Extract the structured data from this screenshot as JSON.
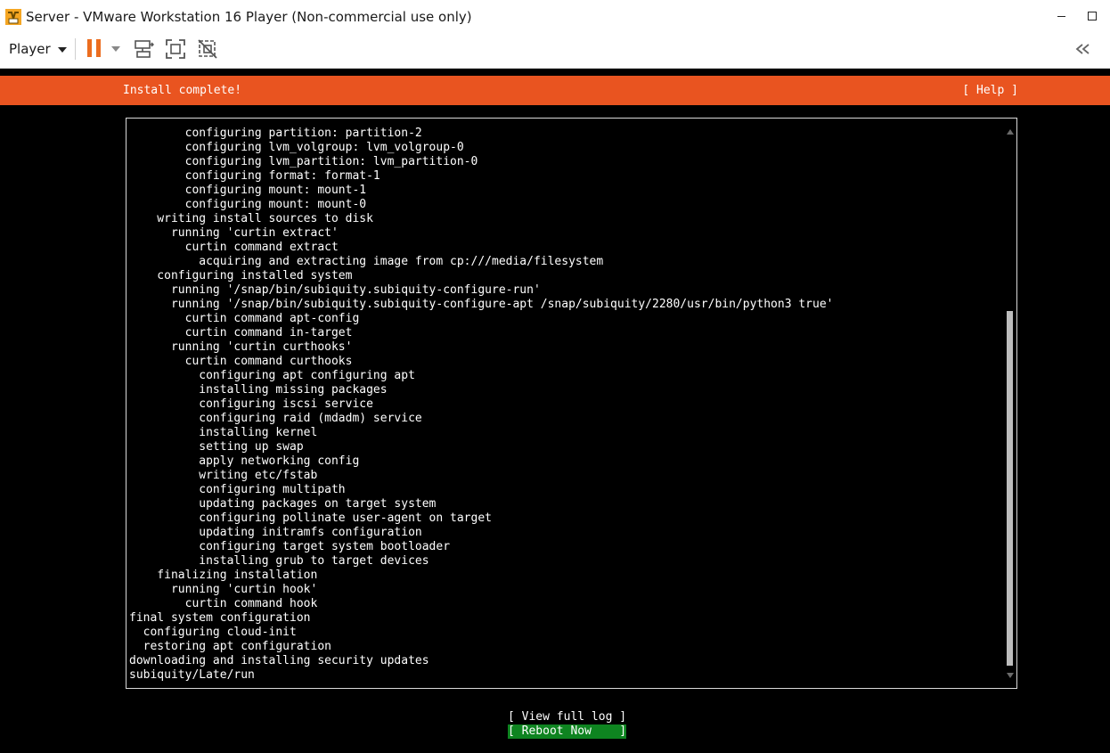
{
  "window": {
    "title": "Server - VMware Workstation 16 Player (Non-commercial use only)",
    "app_icon": "vmware-icon",
    "controls": [
      "minimize-icon",
      "maximize-icon"
    ]
  },
  "toolbar": {
    "player_label": "Player",
    "buttons": [
      "pause-icon",
      "dropdown-caret-icon",
      "send-ctrl-alt-del-icon",
      "full-screen-icon",
      "unity-icon"
    ],
    "right_button": "double-chevron-left-icon",
    "accent_color": "#ec6d1f"
  },
  "installer": {
    "header_title": "Install complete!",
    "help_label": "[ Help ]",
    "header_color": "#e95420",
    "log_lines": [
      "        configuring partition: partition-2",
      "        configuring lvm_volgroup: lvm_volgroup-0",
      "        configuring lvm_partition: lvm_partition-0",
      "        configuring format: format-1",
      "        configuring mount: mount-1",
      "        configuring mount: mount-0",
      "    writing install sources to disk",
      "      running 'curtin extract'",
      "        curtin command extract",
      "          acquiring and extracting image from cp:///media/filesystem",
      "    configuring installed system",
      "      running '/snap/bin/subiquity.subiquity-configure-run'",
      "      running '/snap/bin/subiquity.subiquity-configure-apt /snap/subiquity/2280/usr/bin/python3 true'",
      "        curtin command apt-config",
      "        curtin command in-target",
      "      running 'curtin curthooks'",
      "        curtin command curthooks",
      "          configuring apt configuring apt",
      "          installing missing packages",
      "          configuring iscsi service",
      "          configuring raid (mdadm) service",
      "          installing kernel",
      "          setting up swap",
      "          apply networking config",
      "          writing etc/fstab",
      "          configuring multipath",
      "          updating packages on target system",
      "          configuring pollinate user-agent on target",
      "          updating initramfs configuration",
      "          configuring target system bootloader",
      "          installing grub to target devices",
      "    finalizing installation",
      "      running 'curtin hook'",
      "        curtin command hook",
      "final system configuration",
      "  configuring cloud-init",
      "  restoring apt configuration",
      "downloading and installing security updates",
      "subiquity/Late/run"
    ],
    "actions": {
      "view_full_log": "[ View full log ]",
      "reboot_now": "[ Reboot Now    ]",
      "reboot_color": "#0e8420"
    }
  }
}
